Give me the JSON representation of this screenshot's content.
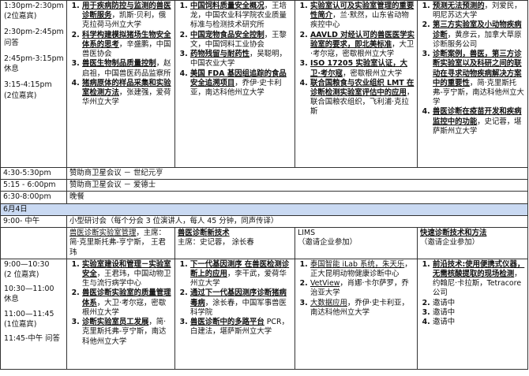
{
  "day1": {
    "slots": [
      "1:30pm-2:30pm",
      "(2位嘉宾)",
      "2:30pm-2:45pm",
      "问答",
      "2:45pm-3:15pm",
      "休息",
      "3:15-4:15pm",
      "(2位嘉宾)"
    ],
    "col1": [
      {
        "title": "用于疾病防控与监测的兽医诊断服务",
        "speaker": "，凯斯·贝利，俄克拉荷马州立大学"
      },
      {
        "title": "科学构建模拟猪场生物安全体系的思考",
        "speaker": "，辛盛鹏，中国兽医协会"
      },
      {
        "title": "兽医生物制品质量控制",
        "speaker": "，赵启祖，中国兽医药品监察所"
      },
      {
        "title": "猪病原体的样品采集和实验室检测方法",
        "speaker": "，张建强，爱荷华州立大学"
      }
    ],
    "col2": [
      {
        "title": "中国饲料质量安全概况",
        "speaker": "，王培龙，中国农业科学院农业质量标准与检测技术研究所"
      },
      {
        "title": "中国宠物食品安全控制",
        "speaker": "，王黎文，中国饲料工业协会"
      },
      {
        "title": "药物残留与耐药性",
        "speaker": "，吴聪明， 中国农业大学"
      },
      {
        "title": "美国 FDA 基因组追踪的食品安全追溯项目",
        "speaker": "，乔伊·史卡利亚，南达科他州立大学"
      }
    ],
    "col3": [
      {
        "title": "实验室认可及实验室管理的重要性简介",
        "speaker": "，兰·默然，山东省动物疾控中心"
      },
      {
        "title": "AAVLD 对经认可的兽医医学实验室的要求，即北美标准",
        "speaker": "，大卫·考尔寇，密歇根州立大学"
      },
      {
        "title": "ISO 17205 实验室认证，大卫·考尔寇",
        "speaker": "，密歇根州立大学"
      },
      {
        "title": "联合国粮食与农业组织 LMT 在诊断检测实验室评估中的应用",
        "speaker": "，联合国粮农组织，飞利浦·克拉斯"
      }
    ],
    "col4": [
      {
        "title": "预测无法预测的",
        "speaker": "，刘爱民，明尼苏达大学"
      },
      {
        "title": "第三方实验室及小动物疾病诊断",
        "speaker": "，黄彦云，加拿大草原诊断服务公司"
      },
      {
        "title": "诊断案例，兽医，第三方诊断实验室以及科研之间的联动在寻求动物疾病解决方案中的重要性",
        "speaker": "，简·克里斯托弗-亨宁斯，南达科他州立大学"
      },
      {
        "title": "兽医诊断在疫苗开发和疾病监控中的功能",
        "speaker": "，史记蓉，堪萨斯州立大学"
      }
    ]
  },
  "rows": [
    {
      "time": "4:30-5:30pm",
      "event": "赞助商卫星会议 － 世纪元亨"
    },
    {
      "time": "5:15 - 6:00pm",
      "event": "赞助商卫星会议 － 爱德士"
    },
    {
      "time": "6:30-8:00pm",
      "event": "晚餐"
    }
  ],
  "date_label": "6月4日",
  "morning": {
    "time": "9:00- 中午",
    "desc": "小型研讨会（每个分会 3 位演讲人，每人 45 分钟，同声传译）"
  },
  "day2": {
    "headers": [
      {
        "title": "兽医诊断实验室管理",
        "chairs": "，主席：简·克里斯托弗-亨宁斯， 王君玮"
      },
      {
        "title": "兽医诊断新技术",
        "chairs": "主席：史记蓉，   涂长春"
      },
      {
        "title": "LIMS",
        "chairs": "（邀请企业参加）"
      },
      {
        "title": "快速诊断技术和方法",
        "chairs": "（邀请企业参加）"
      }
    ],
    "slots": [
      "9:00—10:30",
      "(2 位嘉宾)",
      "10:30—11:00",
      "休息",
      "11:00—11:45",
      "(1位嘉宾)",
      "11:45-中午  问答"
    ],
    "col1": [
      {
        "title": "实验室建设和管理－实验室安全",
        "speaker": "，王君玮，中国动物卫生与流行病学中心"
      },
      {
        "title": "兽医诊断实验室的质量管理体系",
        "speaker": "，大卫·考尔寇，密歇根州立大学"
      },
      {
        "title": "诊断实验室员工发展",
        "speaker": "，简·克里斯托弗-亨宁斯，南达科他州立大学"
      }
    ],
    "col2": [
      {
        "title": "下一代基因测序 在兽医检测诊断上的应用",
        "speaker": "，李干武，爱荷华州立大学"
      },
      {
        "title": "通过下一代基因测序诊断猪病毒病",
        "speaker": "，涂长春，中国军事兽医科学院"
      },
      {
        "title": "兽医诊断中的多路平台",
        "speaker": " PCR，白建法，堪萨斯州立大学"
      }
    ],
    "col3": [
      {
        "link": "泰国智能 iLab 系统，朱天乐",
        "speaker": "，正大昆明动物健康诊断中心"
      },
      {
        "link": "VetView",
        "speaker": "，肖娜·卡尔萨罗，乔治亚大学"
      },
      {
        "link": "大数据应用",
        "speaker": "，乔伊·史卡利亚，南达科他州立大学"
      }
    ],
    "col4": [
      {
        "title": "前沿技术:使用便携式仪器，无需核酸提取的现场检测",
        "speaker": "，约翰尼·卡拉斯，Tetracore公司"
      },
      {
        "title": "",
        "speaker": "邀请中"
      },
      {
        "title": "",
        "speaker": "邀请中"
      },
      {
        "title": "",
        "speaker": "邀请中"
      }
    ]
  }
}
